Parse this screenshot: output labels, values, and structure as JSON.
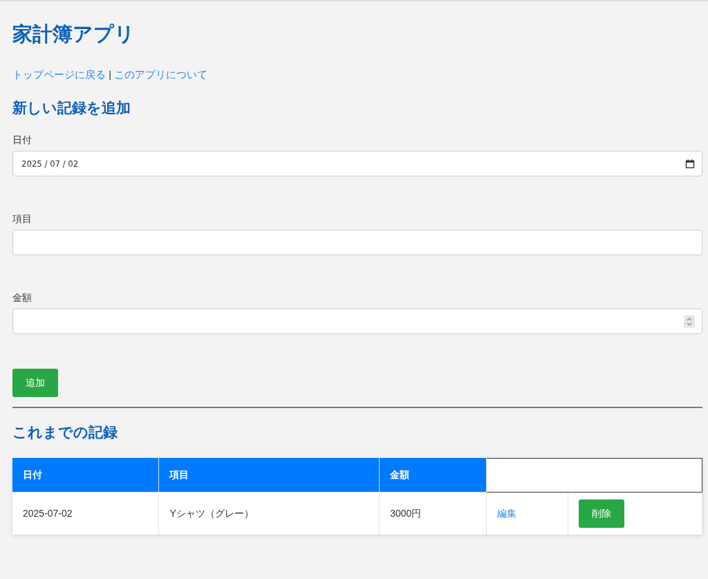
{
  "title": "家計簿アプリ",
  "nav_links": [
    {
      "label": "トップページに戻る"
    },
    {
      "label": "このアプリについて"
    }
  ],
  "separator": "|",
  "form": {
    "heading": "新しい記録を追加",
    "fields": [
      {
        "kind": "date",
        "label": "日付",
        "value": "2025 / 07 / 02"
      },
      {
        "kind": "text",
        "label": "項目"
      },
      {
        "kind": "number",
        "label": "金額"
      }
    ],
    "submit": "追加"
  },
  "records": {
    "heading": "これまでの記録",
    "columns": [
      "日付",
      "項目",
      "金額"
    ],
    "rows": [
      {
        "date": "2025-07-02",
        "item": "Yシャツ（グレー）",
        "amount": "3000円",
        "edit": "編集",
        "delete": "削除"
      }
    ]
  }
}
